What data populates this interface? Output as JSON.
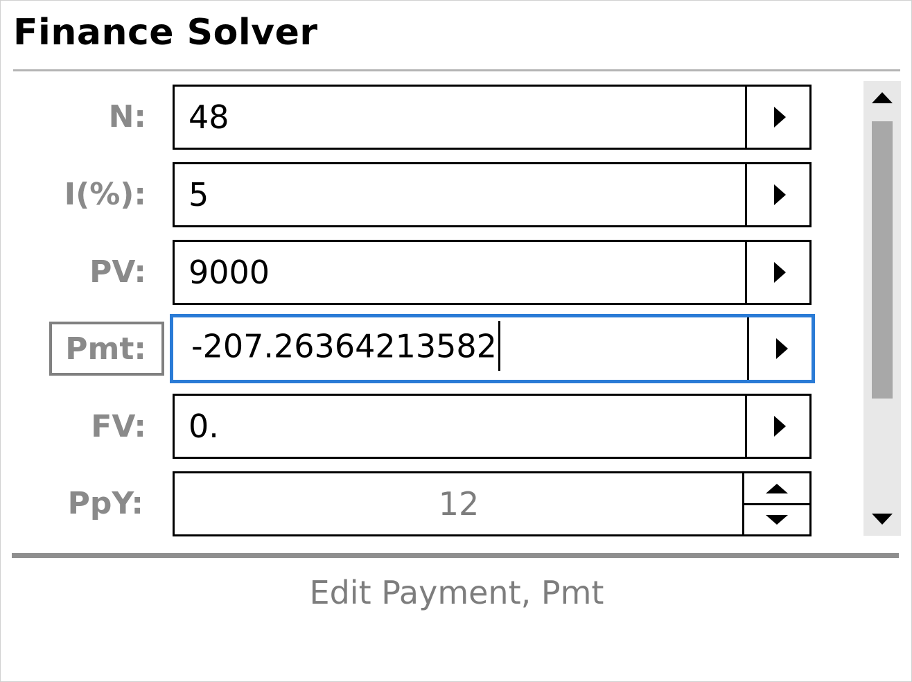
{
  "app": {
    "title": "Finance Solver"
  },
  "fields": [
    {
      "label": "N:",
      "value": "48"
    },
    {
      "label": "I(%):",
      "value": "5"
    },
    {
      "label": "PV:",
      "value": "9000"
    },
    {
      "label": "Pmt:",
      "value": "-207.26364213582"
    },
    {
      "label": "FV:",
      "value": "0."
    },
    {
      "label": "PpY:",
      "value": "12"
    }
  ],
  "status": {
    "text": "Edit Payment, Pmt"
  },
  "colors": {
    "focus_border": "#2a7bd6",
    "label_text": "#8a8a8a"
  },
  "icons": {
    "field_button": "triangle-right-icon",
    "spin_up": "triangle-up-icon",
    "spin_down": "triangle-down-icon"
  }
}
